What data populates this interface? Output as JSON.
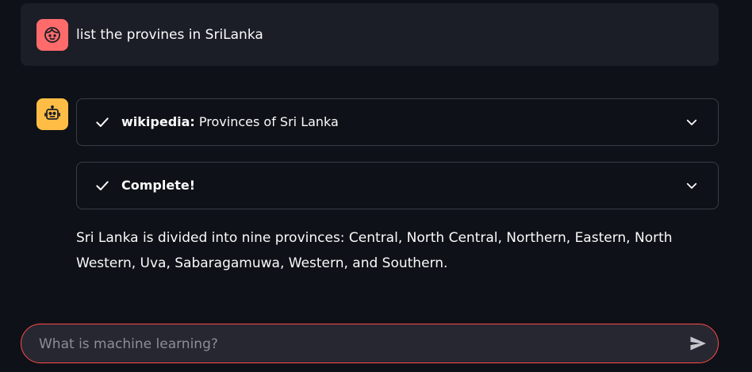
{
  "user_message": {
    "avatar_icon": "user-face-icon",
    "avatar_color": "#ff6b6b",
    "text": "list the provines in SriLanka"
  },
  "assistant_message": {
    "avatar_icon": "robot-icon",
    "avatar_color": "#ffbd45",
    "steps": [
      {
        "status_icon": "check-icon",
        "label_bold": "wikipedia:",
        "label_rest": " Provinces of Sri Lanka",
        "expand_icon": "chevron-down-icon"
      },
      {
        "status_icon": "check-icon",
        "label_bold": "Complete!",
        "label_rest": "",
        "expand_icon": "chevron-down-icon"
      }
    ],
    "answer": "Sri Lanka is divided into nine provinces: Central, North Central, Northern, Eastern, North Western, Uva, Sabaragamuwa, Western, and Southern."
  },
  "chat_input": {
    "placeholder": "What is machine learning?",
    "value": "",
    "border_color": "#ff4b4b",
    "send_icon": "send-icon"
  }
}
